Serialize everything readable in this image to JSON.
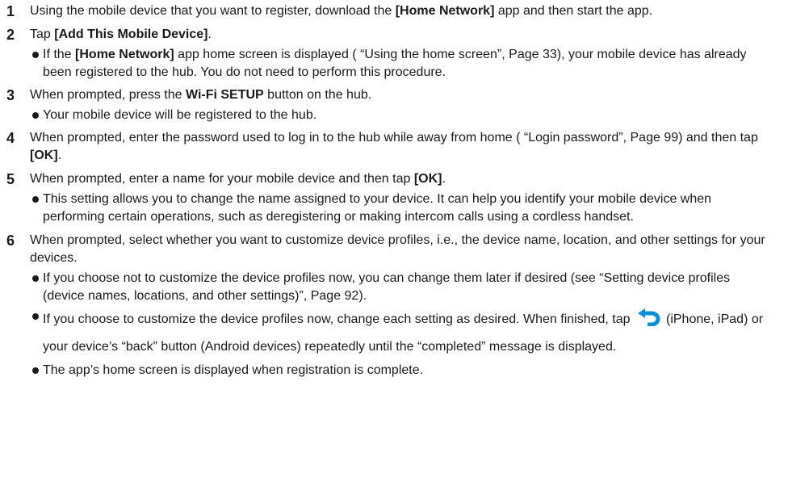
{
  "steps": [
    {
      "number": "1",
      "p1": "Using the mobile device that you want to register, download the ",
      "b1": "[Home Network]",
      "p2": " app and then start the app."
    },
    {
      "number": "2",
      "p1": "Tap ",
      "b1": "[Add This Mobile Device]",
      "p2": ".",
      "bullets": [
        {
          "p1": "If the ",
          "b1": "[Home Network]",
          "p2": " app home screen is displayed ( “Using the home screen”, Page 33), your mobile device has already been registered to the hub. You do not need to perform this procedure."
        }
      ]
    },
    {
      "number": "3",
      "p1": "When prompted, press the ",
      "b1": "Wi-Fi SETUP",
      "p2": " button on the hub.",
      "bullets": [
        {
          "text": "Your mobile device will be registered to the hub."
        }
      ]
    },
    {
      "number": "4",
      "p1": "When prompted, enter the password used to log in to the hub while away from home ( “Login password”, Page 99) and then tap ",
      "b1": "[OK]",
      "p2": "."
    },
    {
      "number": "5",
      "p1": "When prompted, enter a name for your mobile device and then tap ",
      "b1": "[OK]",
      "p2": ".",
      "bullets": [
        {
          "text": "This setting allows you to change the name assigned to your device. It can help you identify your mobile device when performing certain operations, such as deregistering or making intercom calls using a cordless handset."
        }
      ]
    },
    {
      "number": "6",
      "text": "When prompted, select whether you want to customize device profiles, i.e., the device name, location, and other settings for your devices.",
      "bullets": [
        {
          "text": "If you choose not to customize the device profiles now, you can change them later if desired (see “Setting device profiles (device names, locations, and other settings)”, Page 92)."
        },
        {
          "p1": "If you choose to customize the device profiles now, change each setting as desired. When finished, tap",
          "icon": "back-arrow-icon",
          "p2": "(iPhone, iPad) or your device’s “back” button (Android devices) repeatedly until the “completed” message is displayed."
        },
        {
          "text": "The app’s home screen is displayed when registration is complete."
        }
      ]
    }
  ]
}
